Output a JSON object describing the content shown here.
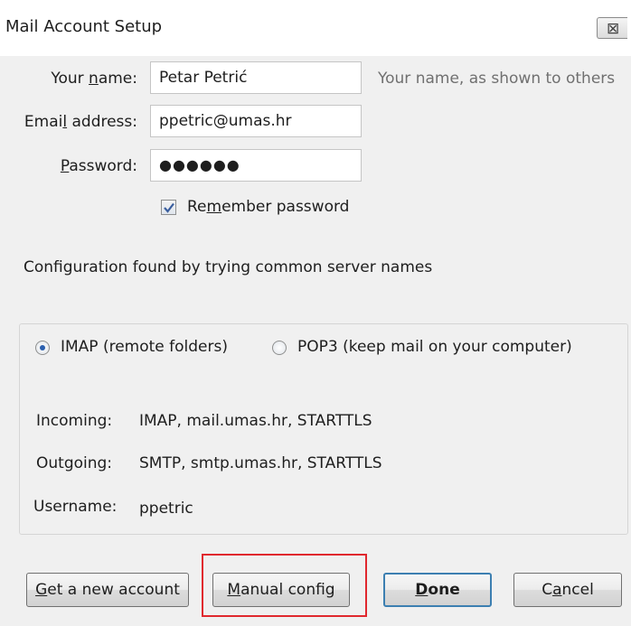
{
  "window": {
    "title": "Mail Account Setup",
    "close_glyph": "⊠"
  },
  "form": {
    "name_label_pre": "Your ",
    "name_label_key": "n",
    "name_label_post": "ame:",
    "name_value": "Petar Petrić",
    "name_hint": "Your name, as shown to others",
    "email_label_pre": "Emai",
    "email_label_key": "l",
    "email_label_post": " address:",
    "email_value": "ppetric@umas.hr",
    "password_label_key": "P",
    "password_label_post": "assword:",
    "password_value": "●●●●●●",
    "remember_pre": "Re",
    "remember_key": "m",
    "remember_post": "ember password",
    "remember_checked": true
  },
  "status": {
    "message": "Configuration found by trying common server names"
  },
  "protocols": {
    "imap_label": "IMAP (remote folders)",
    "pop3_label": "POP3 (keep mail on your computer)",
    "selected": "imap"
  },
  "servers": {
    "incoming_label": "Incoming:",
    "incoming_value": "IMAP, mail.umas.hr, STARTTLS",
    "outgoing_label": "Outgoing:",
    "outgoing_value": "SMTP, smtp.umas.hr, STARTTLS",
    "username_label": "Username:",
    "username_value": "ppetric"
  },
  "buttons": {
    "get_account_key": "G",
    "get_account_post": "et a new account",
    "manual_key": "M",
    "manual_post": "anual config",
    "done_key": "D",
    "done_post": "one",
    "cancel_pre": "C",
    "cancel_key": "a",
    "cancel_post": "ncel"
  },
  "colors": {
    "highlight": "#e0282e",
    "default_button_border": "#3c7fb1",
    "background": "#f0f0f0"
  }
}
